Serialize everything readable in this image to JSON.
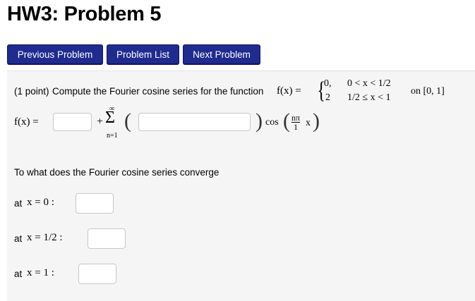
{
  "page": {
    "title": "HW3: Problem 5"
  },
  "nav": {
    "previous": "Previous Problem",
    "list": "Problem List",
    "next": "Next Problem"
  },
  "problem": {
    "points": "(1 point)",
    "prompt": "Compute the Fourier cosine series for the function",
    "function_lhs": "f(x) =",
    "case1_value": "0,",
    "case1_cond": "0 < x < 1/2",
    "case2_value": "2",
    "case2_cond": "1/2 ≤ x < 1",
    "interval": "on [0, 1]",
    "series_lhs": "f(x) =",
    "plus": "+",
    "sum_symbol": "Σ",
    "sum_upper": "∞",
    "sum_lower": "n=1",
    "cos": "cos",
    "frac_num": "nπ",
    "frac_den": "1",
    "x_var": "x",
    "converge_question": "To what does the Fourier cosine series converge",
    "at_label": "at",
    "points_list": [
      {
        "expr": "x = 0 :",
        "value": ""
      },
      {
        "expr": "x = 1/2 :",
        "value": ""
      },
      {
        "expr": "x = 1 :",
        "value": ""
      }
    ],
    "a0_value": "",
    "an_value": ""
  },
  "colors": {
    "button_bg": "#1f2b8f",
    "panel_bg": "#f5f5f5"
  }
}
